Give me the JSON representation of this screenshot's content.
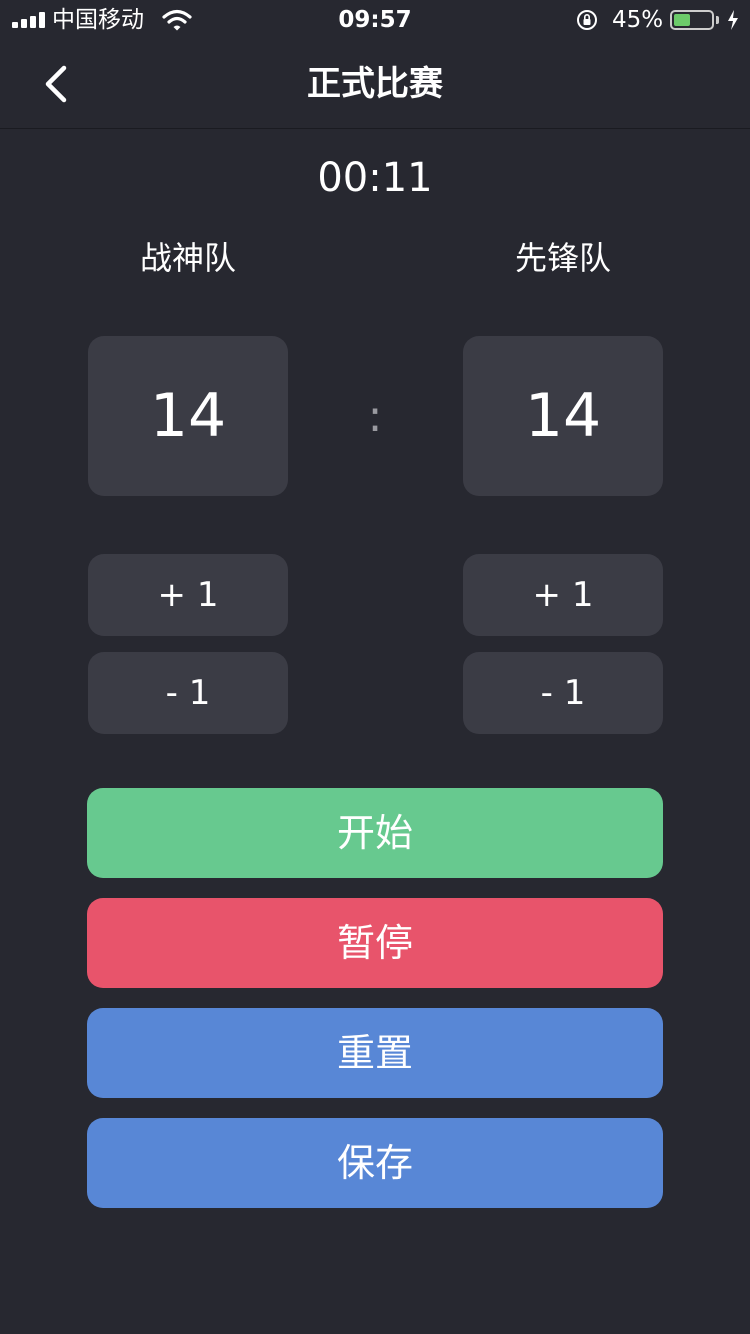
{
  "status_bar": {
    "carrier": "中国移动",
    "time": "09:57",
    "battery_percent": "45%",
    "battery_level": 0.45,
    "icons": [
      "signal-icon",
      "wifi-icon",
      "orientation-lock-icon",
      "battery-icon",
      "charging-icon"
    ]
  },
  "nav": {
    "title": "正式比赛",
    "back_icon": "chevron-left-icon"
  },
  "timer": "00:11",
  "teams": {
    "left": {
      "name": "战神队",
      "score": "14"
    },
    "right": {
      "name": "先锋队",
      "score": "14"
    }
  },
  "separator": ":",
  "controls": {
    "plus_label": "+ 1",
    "minus_label": "- 1"
  },
  "actions": {
    "start": "开始",
    "pause": "暂停",
    "reset": "重置",
    "save": "保存"
  },
  "colors": {
    "background": "#272830",
    "panel": "#3b3c45",
    "start": "#67c98f",
    "pause": "#e8546b",
    "reset": "#5887d6",
    "save": "#5887d6"
  }
}
